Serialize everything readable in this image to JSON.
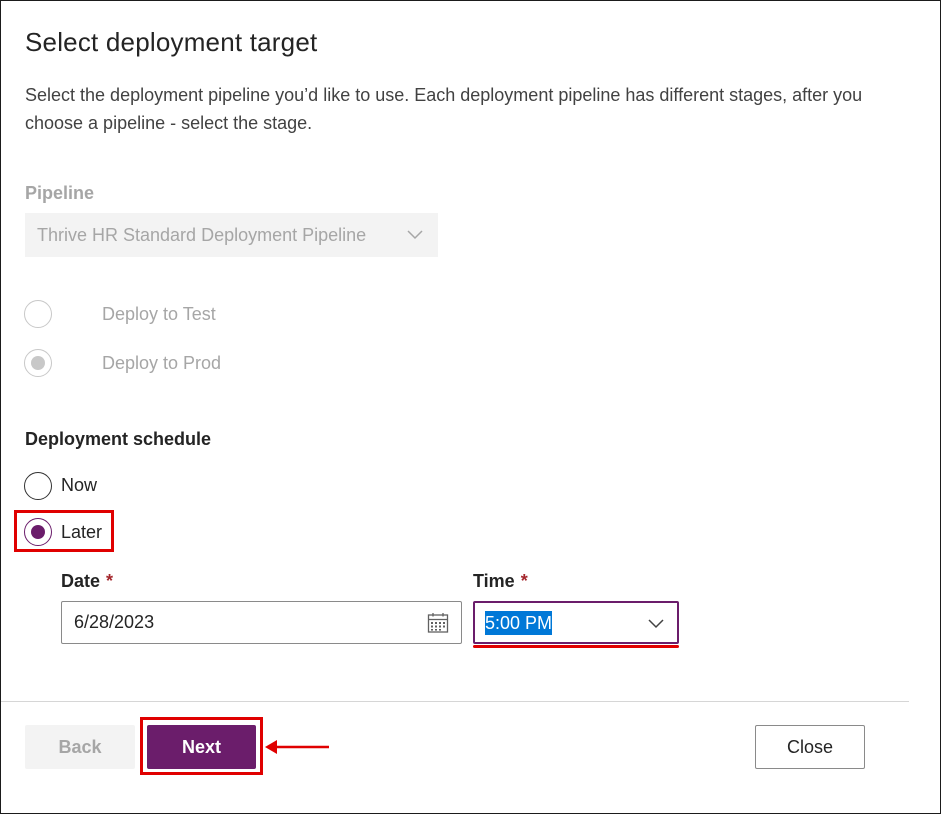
{
  "dialog": {
    "title": "Select deployment target",
    "description": "Select the deployment pipeline you’d like to use. Each deployment pipeline has different stages, after you choose a pipeline - select the stage."
  },
  "pipeline": {
    "label": "Pipeline",
    "selected": "Thrive HR Standard Deployment Pipeline",
    "disabled": true
  },
  "stages": [
    {
      "label": "Deploy to Test",
      "checked": false,
      "disabled": true
    },
    {
      "label": "Deploy to Prod",
      "checked": true,
      "disabled": true
    }
  ],
  "schedule": {
    "label": "Deployment schedule",
    "options": [
      {
        "label": "Now",
        "checked": false
      },
      {
        "label": "Later",
        "checked": true
      }
    ],
    "date": {
      "label": "Date",
      "required_mark": "*",
      "value": "6/28/2023"
    },
    "time": {
      "label": "Time",
      "required_mark": "*",
      "value": "5:00 PM"
    }
  },
  "footer": {
    "back_label": "Back",
    "next_label": "Next",
    "close_label": "Close"
  },
  "colors": {
    "accent": "#6b1d6b",
    "highlight": "#e00000",
    "selection": "#0078d7"
  },
  "icons": {
    "pipeline_dropdown": "chevron-down-icon",
    "date_picker": "calendar-icon",
    "time_dropdown": "chevron-down-icon",
    "annotation": "arrow-left-icon"
  }
}
